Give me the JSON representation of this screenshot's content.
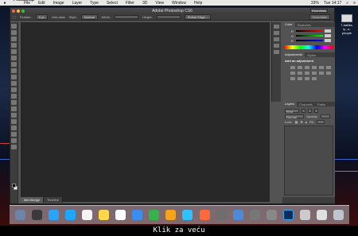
{
  "menubar": {
    "app": "Photoshop",
    "items": [
      "File",
      "Edit",
      "Image",
      "Layer",
      "Type",
      "Select",
      "Filter",
      "3D",
      "View",
      "Window",
      "Help"
    ],
    "battery": "33%",
    "clock": "Tue 14:17"
  },
  "window": {
    "title": "Adobe Photoshop CS6",
    "workspace": "Essentials"
  },
  "options": {
    "feather_label": "Feather:",
    "feather_value": "0 px",
    "antialias": "Anti-alias",
    "style_label": "Style:",
    "style_value": "Normal",
    "width_label": "Width:",
    "height_label": "Height:",
    "refine": "Refine Edge..."
  },
  "color_panel": {
    "tabs": [
      "Color",
      "Swatches"
    ],
    "channels": [
      "R",
      "G",
      "B"
    ]
  },
  "adjustments_panel": {
    "tabs": [
      "Adjustments",
      "Styles"
    ],
    "heading": "Add an adjustment"
  },
  "layers_panel": {
    "tabs": [
      "Layers",
      "Channels",
      "Paths"
    ],
    "kind": "Kind",
    "blend": "Normal",
    "opacity_label": "Opacity:",
    "lock_label": "Lock:",
    "fill_label": "Fill:"
  },
  "bottom_tabs": [
    "Mini Bridge",
    "Timeline"
  ],
  "desktop": {
    "file_label": "7-habits-ly...e-people"
  },
  "caption": "Klik za veću",
  "colors": {
    "accent": "#2f63b5",
    "panel_bg": "#535353",
    "canvas_bg": "#282828"
  }
}
